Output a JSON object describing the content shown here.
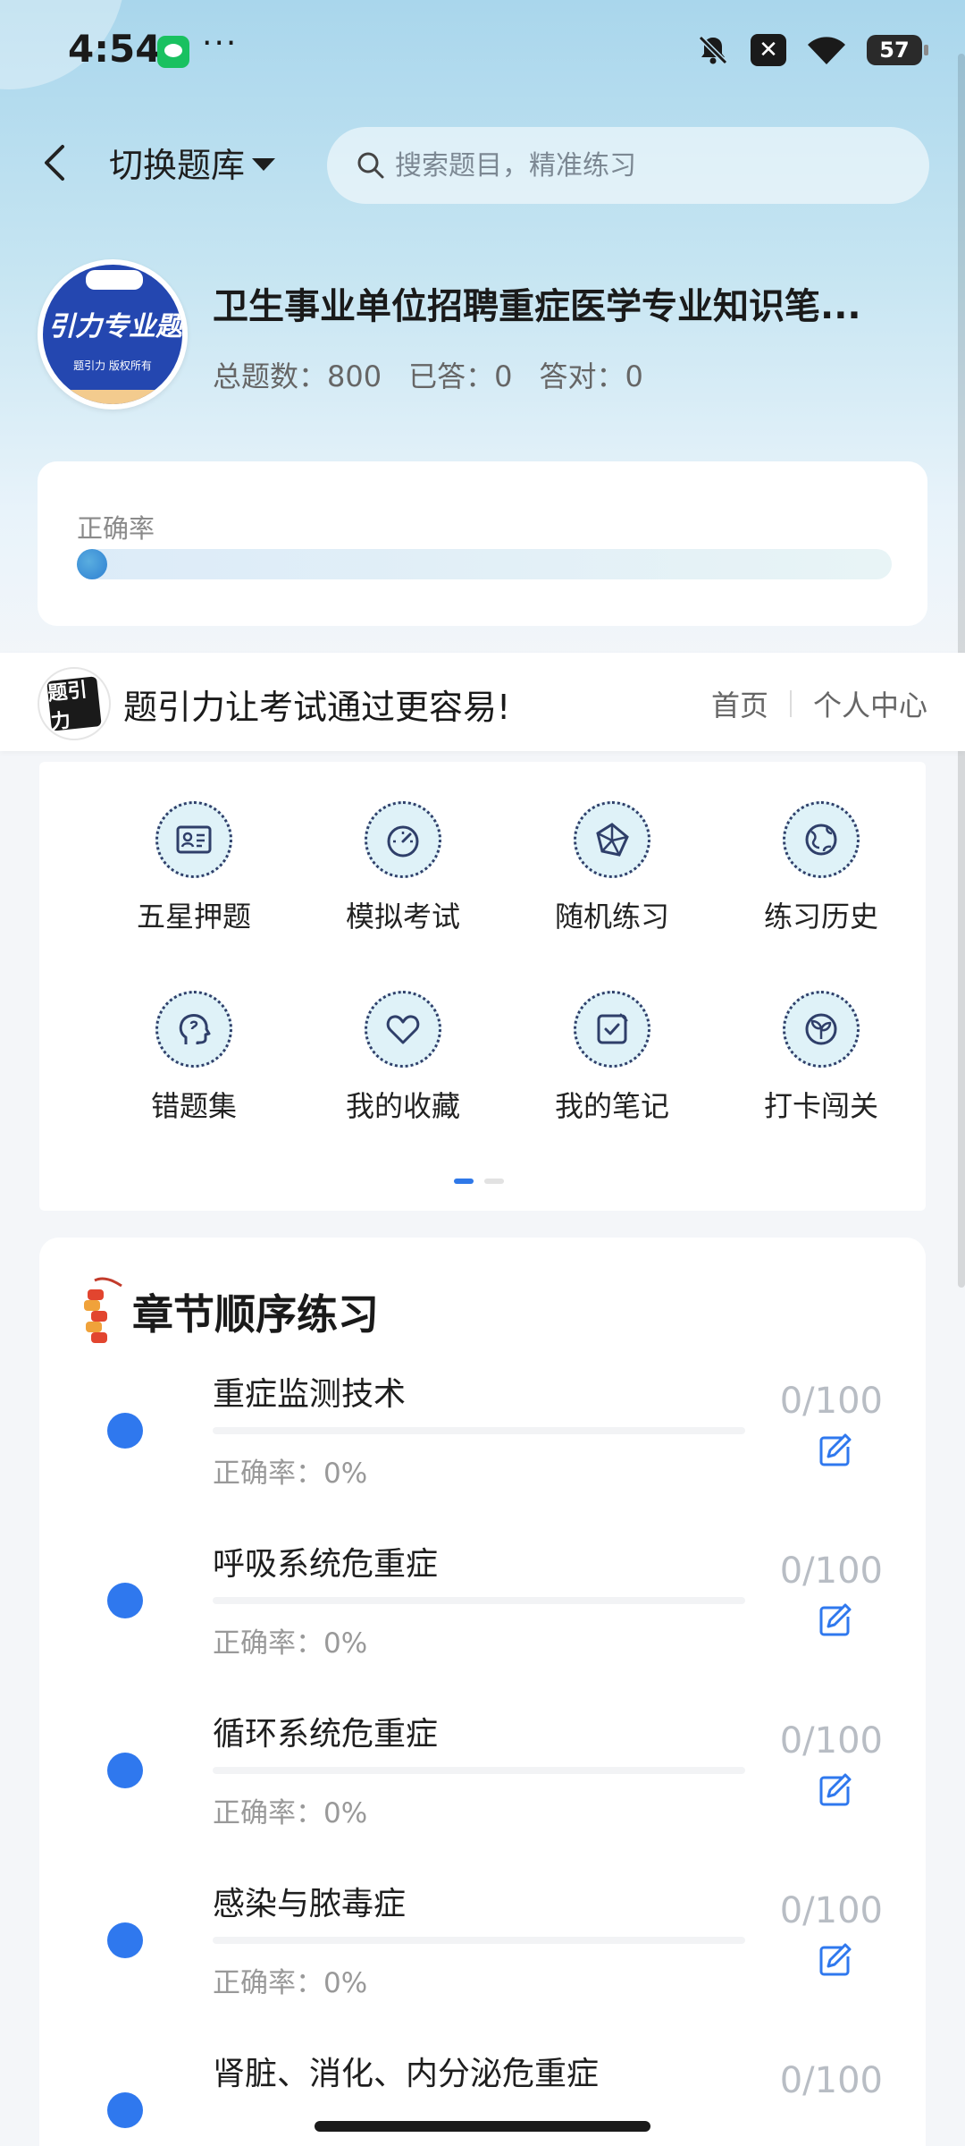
{
  "status_bar": {
    "time": "4:54",
    "dots": "···",
    "battery": "57"
  },
  "header": {
    "switch_label": "切换题库",
    "search_placeholder": "搜索题目，精准练习"
  },
  "bank": {
    "logo_text": "引力专业题",
    "logo_subtext": "题引力 版权所有",
    "title": "卫生事业单位招聘重症医学专业知识笔...",
    "stats": [
      {
        "label": "总题数：",
        "value": "800"
      },
      {
        "label": "已答：",
        "value": "0"
      },
      {
        "label": "答对：",
        "value": "0"
      }
    ]
  },
  "accuracy": {
    "label": "正确率",
    "value": 0
  },
  "slogan": {
    "logo_text": "题引力",
    "text": "题引力让考试通过更容易!",
    "links": [
      "首页",
      "个人中心"
    ]
  },
  "features": [
    {
      "label": "五星押题",
      "icon": "id-card-icon"
    },
    {
      "label": "模拟考试",
      "icon": "gauge-icon"
    },
    {
      "label": "随机练习",
      "icon": "network-icon"
    },
    {
      "label": "练习历史",
      "icon": "globe-icon"
    },
    {
      "label": "错题集",
      "icon": "brain-head-icon"
    },
    {
      "label": "我的收藏",
      "icon": "heart-icon"
    },
    {
      "label": "我的笔记",
      "icon": "note-check-icon"
    },
    {
      "label": "打卡闯关",
      "icon": "sprout-icon"
    }
  ],
  "chapters": {
    "title": "章节顺序练习",
    "items": [
      {
        "name": "重症监测技术",
        "accuracy": "正确率：0%",
        "count": "0/100"
      },
      {
        "name": "呼吸系统危重症",
        "accuracy": "正确率：0%",
        "count": "0/100"
      },
      {
        "name": "循环系统危重症",
        "accuracy": "正确率：0%",
        "count": "0/100"
      },
      {
        "name": "感染与脓毒症",
        "accuracy": "正确率：0%",
        "count": "0/100"
      },
      {
        "name": "肾脏、消化、内分泌危重症",
        "accuracy": "",
        "count": "0/100"
      }
    ]
  },
  "colors": {
    "accent": "#2f78ee",
    "icon_bg": "#dff2f8",
    "icon_stroke": "#2f3f6a"
  }
}
